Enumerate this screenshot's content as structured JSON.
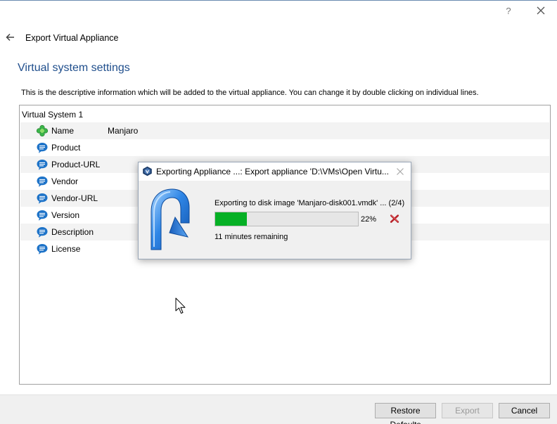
{
  "window": {
    "help_label": "?"
  },
  "wizard": {
    "title": "Export Virtual Appliance",
    "section_title": "Virtual system settings",
    "description": "This is the descriptive information which will be added to the virtual appliance. You can change it by double clicking on individual lines."
  },
  "tree": {
    "root": "Virtual System 1",
    "rows": [
      {
        "label": "Name",
        "value": "Manjaro",
        "icon": "vm-name-icon"
      },
      {
        "label": "Product",
        "value": "",
        "icon": "text-bubble-icon"
      },
      {
        "label": "Product-URL",
        "value": "",
        "icon": "text-bubble-icon"
      },
      {
        "label": "Vendor",
        "value": "",
        "icon": "text-bubble-icon"
      },
      {
        "label": "Vendor-URL",
        "value": "",
        "icon": "text-bubble-icon"
      },
      {
        "label": "Version",
        "value": "",
        "icon": "text-bubble-icon"
      },
      {
        "label": "Description",
        "value": "",
        "icon": "text-bubble-icon"
      },
      {
        "label": "License",
        "value": "",
        "icon": "text-bubble-icon"
      }
    ]
  },
  "footer": {
    "restore_label": "Restore Defaults",
    "export_label": "Export",
    "cancel_label": "Cancel"
  },
  "progress_dialog": {
    "title": "Exporting Appliance ...: Export appliance 'D:\\VMs\\Open Virtu...",
    "operation": "Exporting to disk image 'Manjaro-disk001.vmdk' ... (2/4)",
    "percent_value": 22,
    "percent_label": "22%",
    "remaining": "11 minutes remaining"
  },
  "colors": {
    "section_title": "#1f4e8c",
    "progress_fill": "#06b025",
    "name_icon": "#3bb54a",
    "bubble_icon": "#1e73c8"
  }
}
